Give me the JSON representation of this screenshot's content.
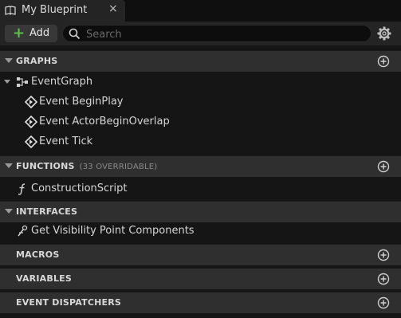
{
  "tab": {
    "title": "My Blueprint",
    "close": "×"
  },
  "toolbar": {
    "add_label": "Add",
    "search_placeholder": "Search"
  },
  "sections": {
    "graphs": {
      "title": "GRAPHS"
    },
    "functions": {
      "title": "FUNCTIONS",
      "subtitle": "(33 OVERRIDABLE)"
    },
    "interfaces": {
      "title": "INTERFACES"
    },
    "macros": {
      "title": "MACROS"
    },
    "variables": {
      "title": "VARIABLES"
    },
    "event_dispatchers": {
      "title": "EVENT DISPATCHERS"
    }
  },
  "graphs": {
    "event_graph": "EventGraph",
    "events": [
      "Event BeginPlay",
      "Event ActorBeginOverlap",
      "Event Tick"
    ]
  },
  "functions": {
    "items": [
      "ConstructionScript"
    ]
  },
  "interfaces": {
    "items": [
      "Get Visibility Point Components"
    ]
  },
  "colors": {
    "accent_green": "#5cc34a",
    "panel": "#242424",
    "header": "#2f2f2f"
  }
}
